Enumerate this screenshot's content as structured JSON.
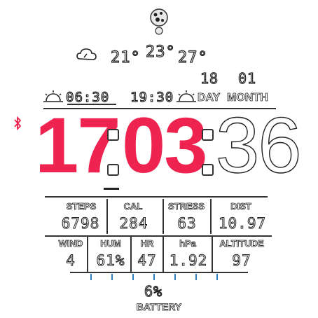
{
  "moon": {
    "icon": "moon-phase-icon"
  },
  "weather": {
    "icon": "partly-cloudy-icon",
    "low": "21°",
    "current": "23°",
    "high": "27°"
  },
  "sun": {
    "sunrise_icon": "sunrise-icon",
    "sunrise": "06:30",
    "sunset": "19:30",
    "sunset_icon": "sunset-icon"
  },
  "date": {
    "day": "18",
    "month": "01",
    "day_label": "DAY",
    "month_label": "MONTH"
  },
  "bluetooth": {
    "icon": "bluetooth-icon",
    "color": "#e8234c"
  },
  "time": {
    "hours": "17",
    "minutes": "03",
    "seconds": "36",
    "accent_color": "#ee2350"
  },
  "stats_row1": [
    {
      "label": "STEPS",
      "value": "6798"
    },
    {
      "label": "CAL",
      "value": "284"
    },
    {
      "label": "STRESS",
      "value": "63"
    },
    {
      "label": "DIST",
      "value": "10.97"
    }
  ],
  "stats_row2": [
    {
      "label": "WIND",
      "value": "4"
    },
    {
      "label": "HUM",
      "value": "61%"
    },
    {
      "label": "HR",
      "value": "47"
    },
    {
      "label": "hPa",
      "value": "1.92"
    },
    {
      "label": "ALTITUDE",
      "value": "97"
    }
  ],
  "battery": {
    "percent": "6%",
    "label": "BATTERY",
    "level": 0.06,
    "tick_color": "#2f7dbb"
  }
}
